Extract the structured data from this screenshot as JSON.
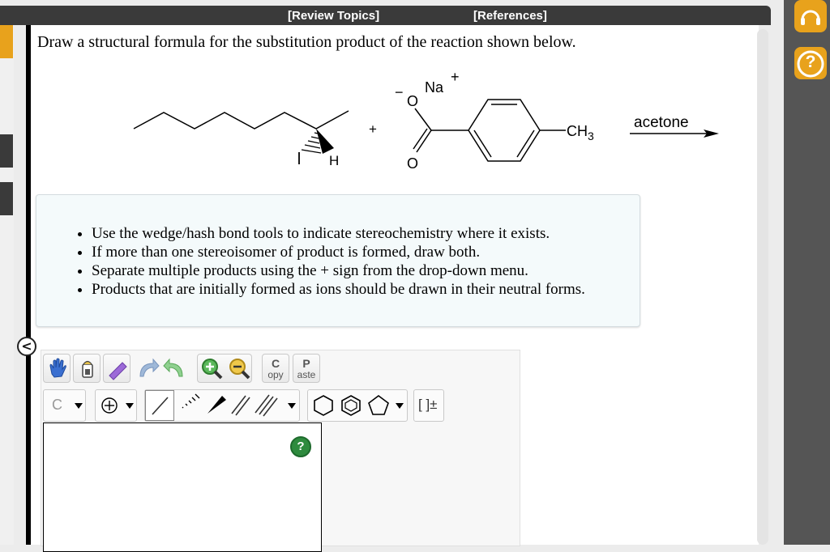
{
  "header": {
    "review_topics": "[Review Topics]",
    "references": "[References]"
  },
  "question": {
    "text": "Draw a structural formula for the substitution product of the reaction shown below."
  },
  "reaction": {
    "hydrogen_label": "H",
    "plus_sign": "+",
    "sodium": "Na",
    "sodium_charge": "+",
    "oxygen_anion": "O",
    "anion_charge": "−",
    "carbonyl_oxygen": "O",
    "methyl": "CH",
    "methyl_subscript": "3",
    "solvent": "acetone"
  },
  "instructions": [
    "Use the wedge/hash bond tools to indicate stereochemistry where it exists.",
    "If more than one stereoisomer of product is formed, draw both.",
    "Separate multiple products using the + sign from the drop-down menu.",
    "Products that are initially formed as ions should be drawn in their neutral forms."
  ],
  "sidebar": {
    "collapse_label": "<"
  },
  "toolbar": {
    "copy": {
      "letter": "C",
      "rest": "opy"
    },
    "paste": {
      "letter": "P",
      "rest": "aste"
    },
    "element": "C",
    "bracket": "[ ]±",
    "help": "?"
  },
  "right_panel": {
    "help": "?"
  },
  "colors": {
    "accent": "#e8a21c",
    "dark_bar": "#3a3a3a",
    "info_bg": "#f4fafb",
    "help_green": "#2e8b3e"
  },
  "icons": [
    "hand-icon",
    "eraser-icon",
    "lasso-icon",
    "undo-icon",
    "redo-icon",
    "zoom-in-icon",
    "zoom-out-icon",
    "charge-icon",
    "single-bond-icon",
    "hash-bond-icon",
    "wedge-bond-icon",
    "double-bond-icon",
    "triple-bond-icon",
    "cyclohexane-icon",
    "benzene-icon",
    "cyclopentane-icon",
    "headset-icon"
  ]
}
